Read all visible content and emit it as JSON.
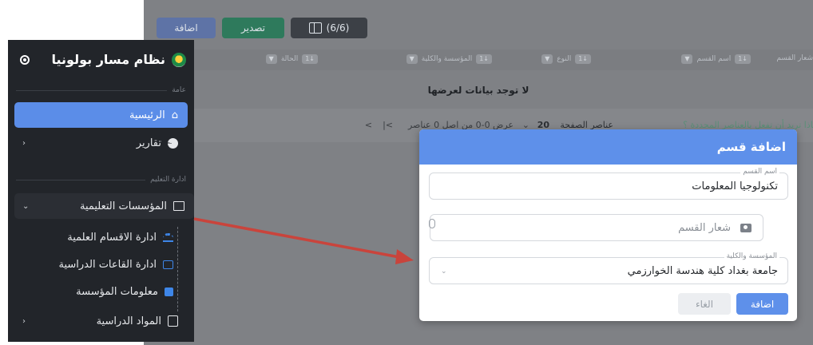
{
  "background": {
    "toolbar": {
      "add_label": "اضافة",
      "export_label": "تصدير",
      "columns_label": "(6/6)"
    },
    "table_headers": [
      {
        "label": "شعار القسم"
      },
      {
        "label": "اسم القسم",
        "chip": "↓1"
      },
      {
        "label": "النوع",
        "chip": "↓1"
      },
      {
        "label": "المؤسسة والكلية",
        "chip": "↓1"
      },
      {
        "label": "الحالة",
        "chip": "↓1"
      }
    ],
    "empty_message": "لا توجد بيانات لعرضها",
    "footer": {
      "bulk_action": "ماذا تريد أن تفعل بالعناصر المحددة ؟",
      "per_page_label": "عناصر الصفحة",
      "per_page_value": "20",
      "range_text": "عرض 0-0 من اصل 0 عناصر",
      "first_icon": ">|",
      "prev_icon": ">"
    }
  },
  "sidebar": {
    "brand": "نظام مسار بولونيا",
    "section_general": "عامة",
    "home": "الرئيسية",
    "reports": "تقارير",
    "section_education": "ادارة التعليم",
    "institutions": "المؤسسات التعليمية",
    "sub_items": [
      {
        "label": "ادارة الاقسام العلمية",
        "icon": "people-icon",
        "color": "#3e86e8"
      },
      {
        "label": "ادارة القاعات الدراسية",
        "icon": "room-icon",
        "color": "#3e86e8"
      },
      {
        "label": "معلومات المؤسسة",
        "icon": "info-icon",
        "color": "#3e86e8"
      }
    ],
    "subjects": "المواد الدراسية"
  },
  "modal": {
    "title": "اضافة قسم",
    "name_legend": "اسم القسم",
    "name_value": "تكنولوجيا المعلومات",
    "logo_placeholder": "شعار القسم",
    "institution_legend": "المؤسسة والكلية",
    "institution_value": "جامعة بغداد كلية هندسة الخوارزمي",
    "cancel_label": "الغاء",
    "submit_label": "اضافة"
  },
  "colors": {
    "accent": "#5e90ea",
    "sidebar_bg": "#22252a",
    "active_item": "#5b8de8",
    "arrow": "#c9443c"
  }
}
